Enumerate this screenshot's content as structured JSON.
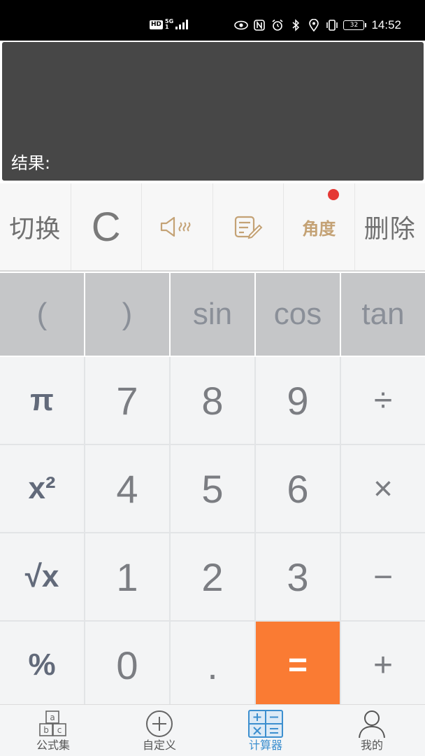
{
  "status_bar": {
    "hd": "HD",
    "network": "5G",
    "signal_sub": "1",
    "battery": "32",
    "time": "14:52",
    "icons": [
      "eye-icon",
      "nfc-icon",
      "alarm-icon",
      "bluetooth-icon",
      "location-icon",
      "vibrate-icon"
    ]
  },
  "display": {
    "result_label": "结果:"
  },
  "function_row": {
    "switch_label": "切换",
    "clear_label": "C",
    "sound_icon": "speaker-icon",
    "history_icon": "note-edit-icon",
    "angle_label": "角度",
    "delete_label": "删除"
  },
  "scientific_row": [
    "(",
    ")",
    "sin",
    "cos",
    "tan"
  ],
  "keypad": {
    "row1": [
      "π",
      "7",
      "8",
      "9",
      "÷"
    ],
    "row2": [
      "x²",
      "4",
      "5",
      "6",
      "×"
    ],
    "row3": [
      "√x",
      "1",
      "2",
      "3",
      "−"
    ],
    "row4": [
      "%",
      "0",
      ".",
      "=",
      "+"
    ]
  },
  "bottom_nav": {
    "items": [
      {
        "label": "公式集",
        "icon": "abc-blocks-icon",
        "active": false
      },
      {
        "label": "自定义",
        "icon": "plus-circle-icon",
        "active": false
      },
      {
        "label": "计算器",
        "icon": "calculator-icon",
        "active": true
      },
      {
        "label": "我的",
        "icon": "user-icon",
        "active": false
      }
    ]
  },
  "colors": {
    "display_bg": "#474747",
    "equals_bg": "#fa7b33",
    "accent_active": "#3c8fcf",
    "angle_gold": "#c4a275",
    "notification_dot": "#e53935"
  }
}
